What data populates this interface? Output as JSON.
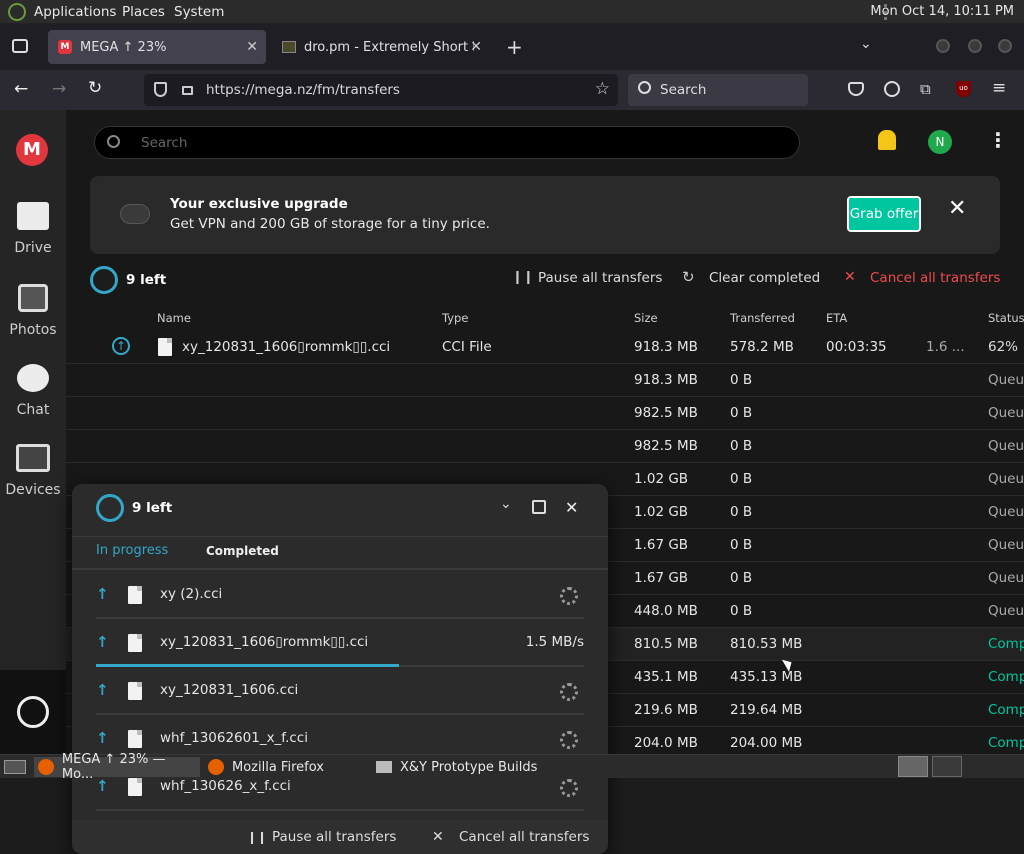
{
  "system_panel": {
    "menus": [
      "Applications",
      "Places",
      "System"
    ],
    "clock": "Mon Oct 14, 10:11 PM"
  },
  "browser": {
    "tabs": [
      {
        "label": "MEGA ↑ 23%"
      },
      {
        "label": "dro.pm - Extremely Short Li"
      }
    ],
    "url": "https://mega.nz/fm/transfers",
    "search_placeholder": "Search"
  },
  "mega": {
    "search_placeholder": "Search",
    "avatar_initial": "N",
    "sidebar": [
      {
        "label": "Drive"
      },
      {
        "label": "Photos"
      },
      {
        "label": "Chat"
      },
      {
        "label": "Devices"
      }
    ],
    "banner": {
      "title": "Your exclusive upgrade",
      "text": "Get VPN and 200 GB of storage for a tiny price.",
      "button": "Grab offer"
    },
    "transfers": {
      "left": "9 left",
      "pause_all": "Pause all transfers",
      "clear_completed": "Clear completed",
      "cancel_all": "Cancel all transfers",
      "columns": [
        "Name",
        "Type",
        "Size",
        "Transferred",
        "ETA",
        "Status"
      ],
      "rows": [
        {
          "name": "xy_120831_1606▯rommk▯▯.cci",
          "type": "CCI File",
          "size": "918.3 MB",
          "transferred": "578.2 MB",
          "eta": "00:03:35",
          "speed": "1.6 ...",
          "status": "62%"
        },
        {
          "name": "",
          "type": "",
          "size": "918.3 MB",
          "transferred": "0 B",
          "eta": "",
          "speed": "",
          "status": "Queu"
        },
        {
          "name": "",
          "type": "",
          "size": "982.5 MB",
          "transferred": "0 B",
          "eta": "",
          "speed": "",
          "status": "Queu"
        },
        {
          "name": "",
          "type": "",
          "size": "982.5 MB",
          "transferred": "0 B",
          "eta": "",
          "speed": "",
          "status": "Queu"
        },
        {
          "name": "",
          "type": "",
          "size": "1.02 GB",
          "transferred": "0 B",
          "eta": "",
          "speed": "",
          "status": "Queu"
        },
        {
          "name": "",
          "type": "",
          "size": "1.02 GB",
          "transferred": "0 B",
          "eta": "",
          "speed": "",
          "status": "Queu"
        },
        {
          "name": "",
          "type": "",
          "size": "1.67 GB",
          "transferred": "0 B",
          "eta": "",
          "speed": "",
          "status": "Queu"
        },
        {
          "name": "",
          "type": "",
          "size": "1.67 GB",
          "transferred": "0 B",
          "eta": "",
          "speed": "",
          "status": "Queu"
        },
        {
          "name": "",
          "type": "",
          "size": "448.0 MB",
          "transferred": "0 B",
          "eta": "",
          "speed": "",
          "status": "Queu"
        },
        {
          "name": "",
          "type": "",
          "size": "810.5 MB",
          "transferred": "810.53 MB",
          "eta": "",
          "speed": "",
          "status": "Comp"
        },
        {
          "name": "",
          "type": "",
          "size": "435.1 MB",
          "transferred": "435.13 MB",
          "eta": "",
          "speed": "",
          "status": "Comp"
        },
        {
          "name": "",
          "type": "",
          "size": "219.6 MB",
          "transferred": "219.64 MB",
          "eta": "",
          "speed": "",
          "status": "Comp"
        },
        {
          "name": "",
          "type": "",
          "size": "204.0 MB",
          "transferred": "204.00 MB",
          "eta": "",
          "speed": "",
          "status": "Comp"
        }
      ]
    },
    "popup": {
      "left": "9 left",
      "tab_in_progress": "In progress",
      "tab_completed": "Completed",
      "items": [
        {
          "name": "xy (2).cci",
          "speed": "",
          "progress": 0
        },
        {
          "name": "xy_120831_1606▯rommk▯▯.cci",
          "speed": "1.5 MB/s",
          "progress": 0.62
        },
        {
          "name": "xy_120831_1606.cci",
          "speed": "",
          "progress": 0
        },
        {
          "name": "whf_13062601_x_f.cci",
          "speed": "",
          "progress": 0
        },
        {
          "name": "whf_130626_x_f.cci",
          "speed": "",
          "progress": 0
        }
      ],
      "pause_all": "Pause all transfers",
      "cancel_all": "Cancel all transfers"
    }
  },
  "taskbar": {
    "items": [
      {
        "label": "MEGA ↑ 23% — Mo..."
      },
      {
        "label": "Mozilla Firefox"
      },
      {
        "label": "X&Y Prototype Builds"
      }
    ]
  },
  "colors": {
    "accent_teal": "#00c6a0",
    "mega_red": "#e2363f",
    "cancel_red": "#f04a4f",
    "status_blue": "#33a7c8"
  }
}
